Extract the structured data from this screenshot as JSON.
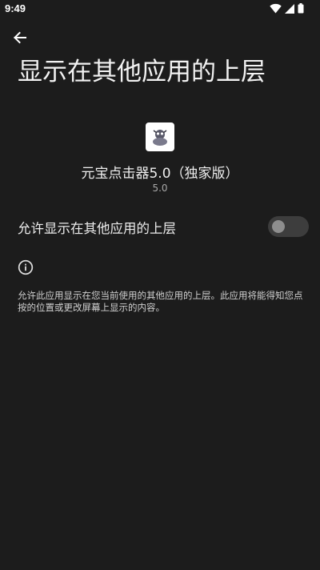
{
  "status_bar": {
    "time": "9:49",
    "icons": [
      "wifi-icon",
      "cellular-signal-icon",
      "battery-icon"
    ]
  },
  "header": {
    "back_icon": "arrow-back-icon",
    "title": "显示在其他应用的上层"
  },
  "app": {
    "icon": "app-icon",
    "name": "元宝点击器5.0（独家版）",
    "version": "5.0"
  },
  "permission": {
    "label": "允许显示在其他应用的上层",
    "enabled": false
  },
  "info": {
    "icon": "info-icon",
    "description": "允许此应用显示在您当前使用的其他应用的上层。此应用将能得知您点按的位置或更改屏幕上显示的内容。"
  },
  "colors": {
    "background": "#1c1c1c",
    "text_primary": "#f2f2f2",
    "text_secondary": "#a8a8a8",
    "toggle_track_off": "#3d3d3d",
    "toggle_knob_off": "#8e8e8e"
  }
}
